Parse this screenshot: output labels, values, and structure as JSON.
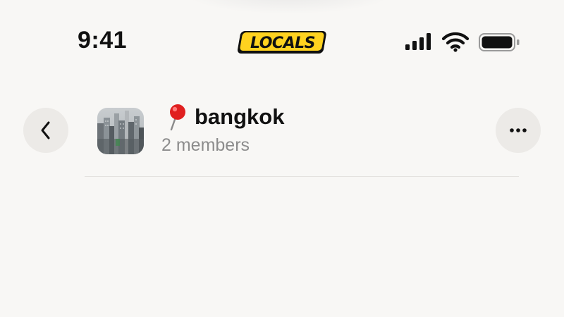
{
  "status_bar": {
    "time": "9:41",
    "logo_text": "LOCALS",
    "signal_icon": "cellular-signal-icon",
    "wifi_icon": "wifi-icon",
    "battery_icon": "battery-icon"
  },
  "header": {
    "back_icon": "chevron-left-icon",
    "group_pin_emoji": "📍",
    "group_name": "bangkok",
    "member_count": "2 members",
    "more_icon": "ellipsis-icon"
  },
  "colors": {
    "background": "#f8f7f5",
    "button_bg": "#eceae7",
    "logo_yellow": "#ffd21f",
    "pin_red": "#e02020",
    "subtitle_gray": "#8c8c8c"
  }
}
